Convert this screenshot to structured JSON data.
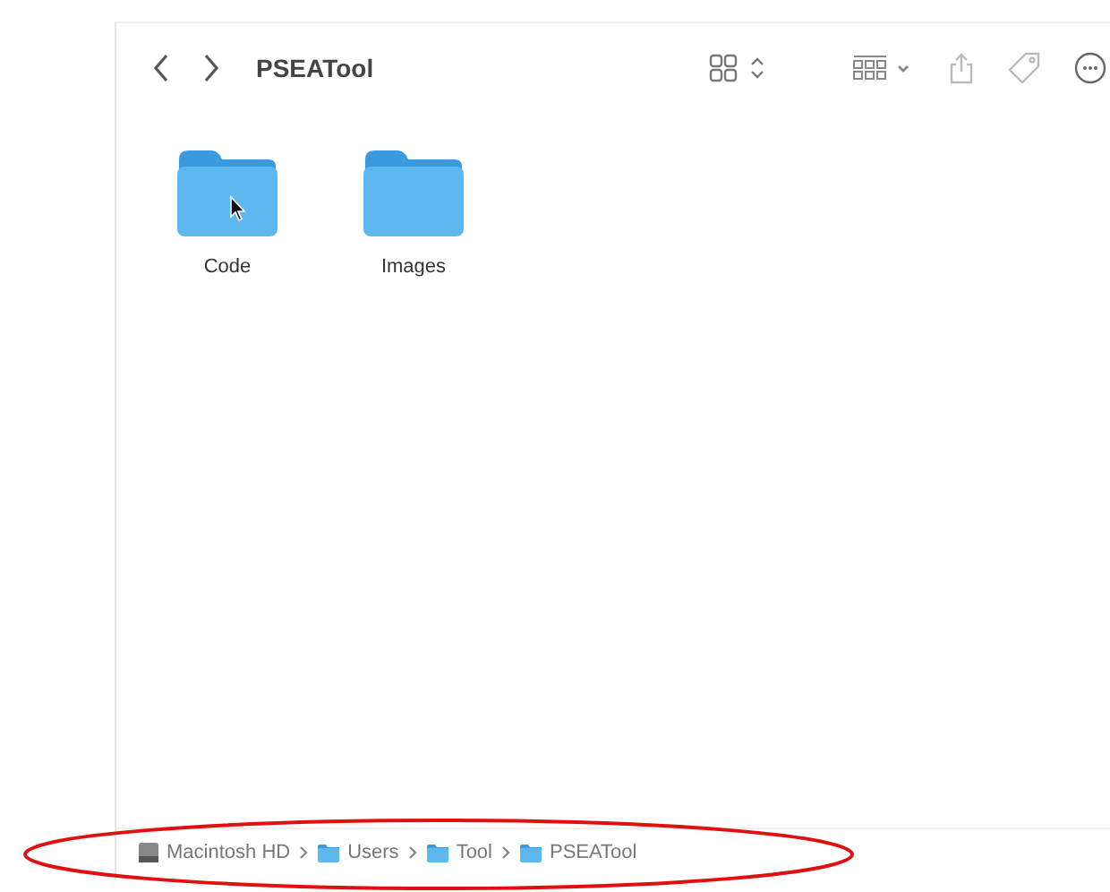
{
  "window": {
    "title": "PSEATool"
  },
  "items": [
    {
      "name": "Code",
      "hovered": true
    },
    {
      "name": "Images",
      "hovered": false
    }
  ],
  "path_bar": [
    {
      "label": "Macintosh HD",
      "kind": "disk"
    },
    {
      "label": "Users",
      "kind": "folder"
    },
    {
      "label": "Tool",
      "kind": "folder"
    },
    {
      "label": "PSEATool",
      "kind": "folder"
    }
  ]
}
